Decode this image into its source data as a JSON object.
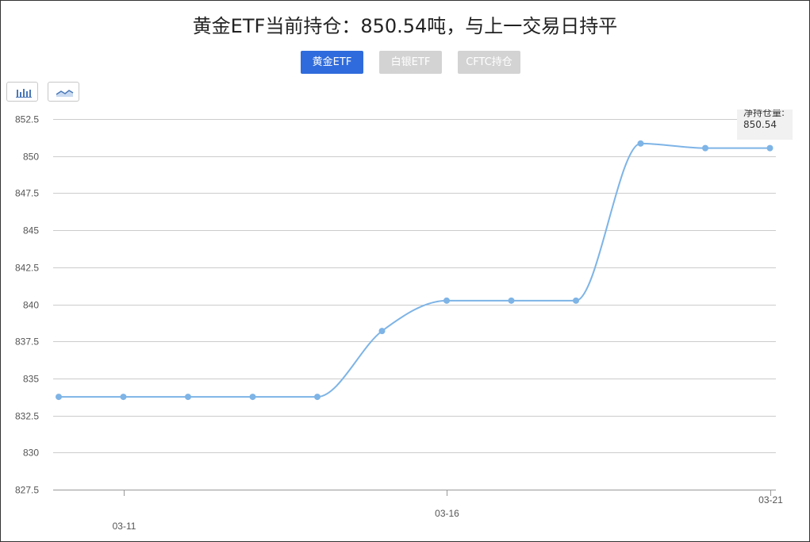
{
  "title": "黄金ETF当前持仓：850.54吨，与上一交易日持平",
  "tabs": [
    {
      "label": "黄金ETF",
      "active": true
    },
    {
      "label": "白银ETF",
      "active": false
    },
    {
      "label": "CFTC持仓",
      "active": false
    }
  ],
  "toolbar": {
    "bar_icon": "bar-chart-icon",
    "line_icon": "line-chart-icon"
  },
  "tooltip": {
    "label": "净持仓量:",
    "value": "850.54"
  },
  "colors": {
    "accent": "#2f6bdc",
    "inactive_tab": "#d3d3d3",
    "series": "#7eb4e6",
    "grid": "#cccccc"
  },
  "chart_data": {
    "type": "line",
    "title": "",
    "xlabel": "",
    "ylabel": "",
    "ylim": [
      827.5,
      852.5
    ],
    "yticks": [
      "852.5",
      "850",
      "847.5",
      "845",
      "842.5",
      "840",
      "837.5",
      "835",
      "832.5",
      "830",
      "827.5"
    ],
    "x_tick_labels": [
      {
        "label": "03-11",
        "index": 1
      },
      {
        "label": "03-16",
        "index": 6
      },
      {
        "label": "03-21",
        "index": 11
      }
    ],
    "grid": true,
    "smooth": true,
    "series": [
      {
        "values": [
          833.76,
          833.76,
          833.76,
          833.76,
          833.76,
          838.2,
          840.25,
          840.25,
          840.25,
          850.85,
          850.54,
          850.54
        ]
      }
    ]
  }
}
